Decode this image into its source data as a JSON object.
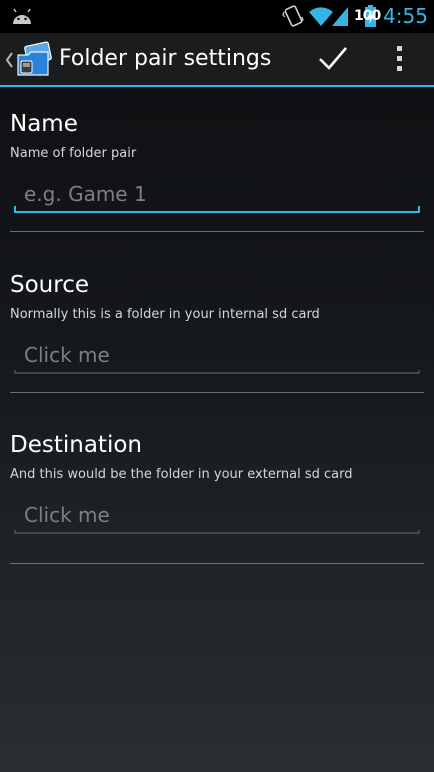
{
  "status_bar": {
    "battery_level": "100",
    "time": "4:55"
  },
  "action_bar": {
    "title": "Folder pair settings",
    "accent_color": "#33b5e5"
  },
  "sections": {
    "name": {
      "heading": "Name",
      "subtitle": "Name of folder pair",
      "placeholder": "e.g. Game 1"
    },
    "source": {
      "heading": "Source",
      "subtitle": "Normally this is a folder in your internal sd card",
      "value": "Click me"
    },
    "destination": {
      "heading": "Destination",
      "subtitle": "And this would be the folder in your external sd card",
      "value": "Click me"
    }
  }
}
